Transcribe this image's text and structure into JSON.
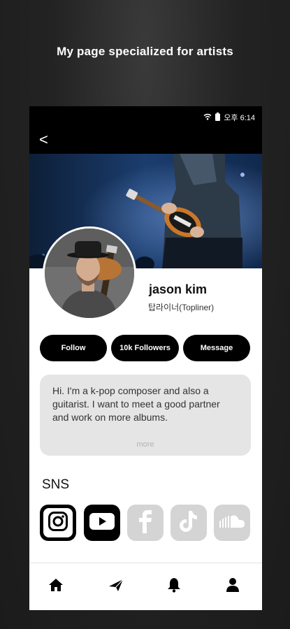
{
  "promo": {
    "headline": "My page specialized for artists"
  },
  "status_bar": {
    "time": "오후 6:14"
  },
  "app_bar": {
    "back_label": "<"
  },
  "profile": {
    "name": "jason kim",
    "role": "탑라이너(Topliner)"
  },
  "actions": {
    "follow_label": "Follow",
    "followers_label": "10k Followers",
    "message_label": "Message"
  },
  "bio": {
    "text": "Hi. I'm a k-pop composer and also a guitarist. I want to meet a good partner and work on more albums.",
    "more_label": "more"
  },
  "sns": {
    "title": "SNS",
    "links": [
      {
        "icon": "instagram-icon",
        "active": true
      },
      {
        "icon": "youtube-icon",
        "active": true
      },
      {
        "icon": "facebook-icon",
        "active": false
      },
      {
        "icon": "tiktok-icon",
        "active": false
      },
      {
        "icon": "soundcloud-icon",
        "active": false
      }
    ]
  },
  "bottom_nav": {
    "items": [
      {
        "icon": "home-icon"
      },
      {
        "icon": "send-icon"
      },
      {
        "icon": "bell-icon"
      },
      {
        "icon": "profile-icon"
      }
    ]
  },
  "colors": {
    "accent": "#000000",
    "bio_background": "#e5e5e5",
    "inactive_sns": "#d4d4d4"
  }
}
